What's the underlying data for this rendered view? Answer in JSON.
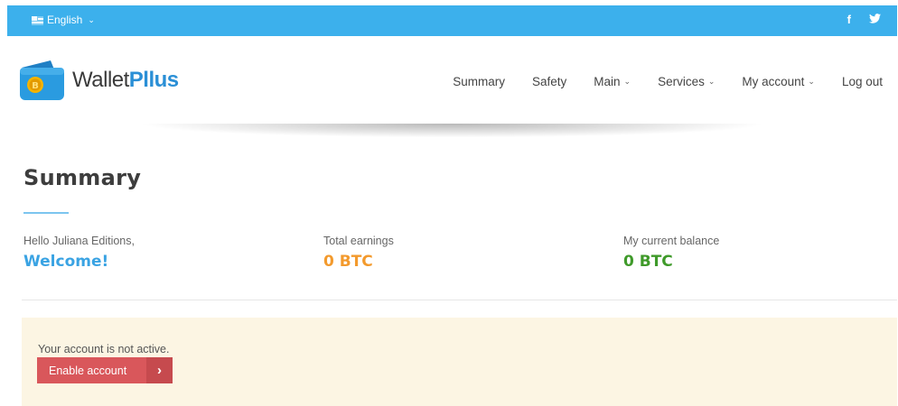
{
  "topbar": {
    "language": "English",
    "icons": [
      "flag-icon",
      "facebook-icon",
      "twitter-icon"
    ],
    "facebook_glyph": "f",
    "twitter_glyph": "🐦"
  },
  "brand": {
    "name_part1": "Wallet",
    "name_part2": "Pllus",
    "coin_glyph": "B"
  },
  "nav": {
    "items": [
      {
        "label": "Summary",
        "has_dropdown": false
      },
      {
        "label": "Safety",
        "has_dropdown": false
      },
      {
        "label": "Main",
        "has_dropdown": true
      },
      {
        "label": "Services",
        "has_dropdown": true
      },
      {
        "label": "My account",
        "has_dropdown": true
      },
      {
        "label": "Log out",
        "has_dropdown": false
      }
    ]
  },
  "page": {
    "title": "Summary"
  },
  "stats": {
    "greeting": "Hello Juliana Editions,",
    "welcome": "Welcome!",
    "earnings_label": "Total earnings",
    "earnings_value": "0 BTC",
    "balance_label": "My current balance",
    "balance_value": "0 BTC"
  },
  "notice": {
    "message": "Your account is not active.",
    "button_label": "Enable account",
    "button_arrow": "›"
  },
  "colors": {
    "topbar": "#3cb0ec",
    "brand_accent": "#2a8fd6",
    "welcome": "#3aa3e3",
    "earnings": "#f39a2d",
    "balance": "#3f9a2a",
    "notice_bg": "#fcf5e3",
    "button": "#d9575b"
  }
}
